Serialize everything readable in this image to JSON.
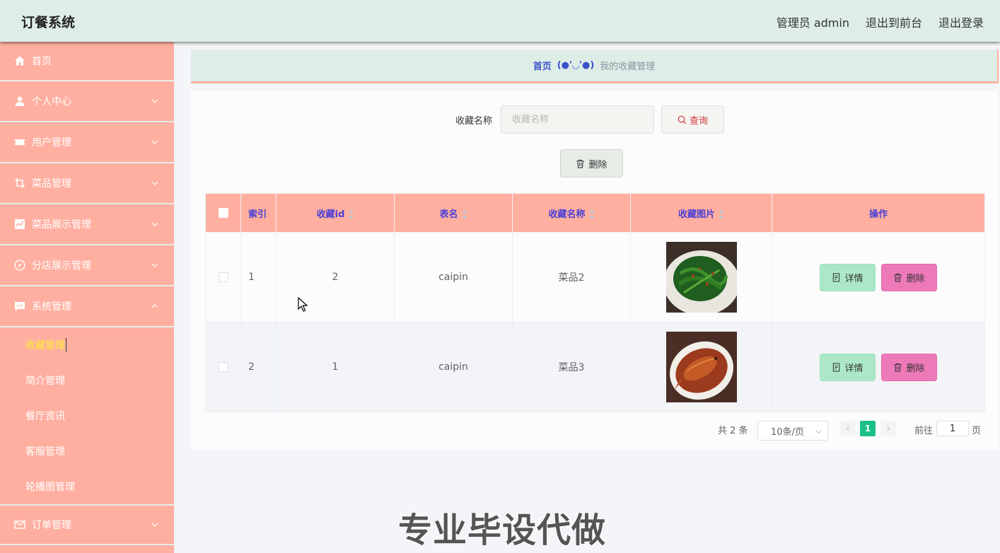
{
  "app": {
    "title": "订餐系统"
  },
  "header": {
    "user": "管理员 admin",
    "front": "退出到前台",
    "logout": "退出登录"
  },
  "sidebar": {
    "items": [
      {
        "label": "首页",
        "icon": "home-icon"
      },
      {
        "label": "个人中心",
        "icon": "user-icon"
      },
      {
        "label": "用户管理",
        "icon": "ticket-icon"
      },
      {
        "label": "菜品管理",
        "icon": "crop-icon"
      },
      {
        "label": "菜品展示管理",
        "icon": "chart-icon"
      },
      {
        "label": "分店展示管理",
        "icon": "compass-icon"
      },
      {
        "label": "系统管理",
        "icon": "chat-icon"
      }
    ],
    "submenu": [
      "收藏管理",
      "简介管理",
      "餐厅资讯",
      "客服管理",
      "轮播图管理"
    ],
    "after": {
      "label": "订单管理",
      "icon": "mail-icon"
    }
  },
  "breadcrumb": {
    "home": "首页",
    "face": "(●'◡'●)",
    "current": "我的收藏管理"
  },
  "search": {
    "label": "收藏名称",
    "placeholder": "收藏名称",
    "button": "查询"
  },
  "toolbar": {
    "delete_label": "删除"
  },
  "table": {
    "headers": {
      "index": "索引",
      "id": "收藏id",
      "table": "表名",
      "name": "收藏名称",
      "image": "收藏图片",
      "ops": "操作"
    },
    "rows": [
      {
        "index": "1",
        "id": "2",
        "table": "caipin",
        "name": "菜品2",
        "image": "stir-fried greens dish"
      },
      {
        "index": "2",
        "id": "1",
        "table": "caipin",
        "name": "菜品3",
        "image": "braised fish dish"
      }
    ],
    "detail_label": "详情",
    "delete_label": "删除"
  },
  "pagination": {
    "total": "共 2 条",
    "page_size": "10条/页",
    "current": "1",
    "goto_label": "前往",
    "goto_value": "1",
    "goto_unit": "页"
  },
  "watermark": "专业毕设代做",
  "colors": {
    "sidebar": "#ffafa0",
    "header": "#deeee7",
    "accent": "#1bbf8a",
    "detail": "#ace8c8",
    "delete": "#ee79b9",
    "header_text": "#4a3fd6"
  }
}
